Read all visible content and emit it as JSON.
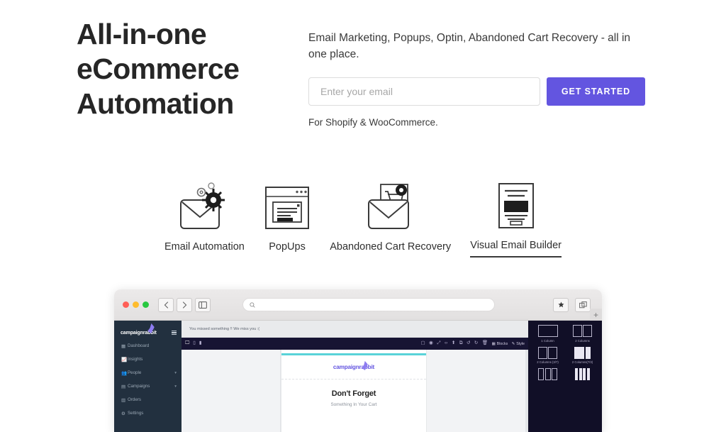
{
  "hero": {
    "headline": "All-in-one eCommerce Automation",
    "subhead": "Email Marketing, Popups, Optin, Abandoned Cart Recovery - all in one place.",
    "email_placeholder": "Enter your email",
    "email_value": "",
    "cta_label": "GET STARTED",
    "note": "For Shopify & WooCommerce.",
    "accent_color": "#6355e0"
  },
  "features": [
    {
      "label": "Email Automation",
      "icon": "email-gears-icon",
      "active": false
    },
    {
      "label": "PopUps",
      "icon": "popup-window-icon",
      "active": false
    },
    {
      "label": "Abandoned Cart Recovery",
      "icon": "cart-email-icon",
      "active": false
    },
    {
      "label": "Visual Email Builder",
      "icon": "email-template-icon",
      "active": true
    }
  ],
  "browser": {
    "traffic_lights": [
      "close-red",
      "minimize-yellow",
      "maximize-green"
    ],
    "back_icon": "chevron-left-icon",
    "forward_icon": "chevron-right-icon",
    "sidebar_icon": "sidebar-toggle-icon",
    "address_placeholder": "",
    "address_value": "",
    "search_icon": "search-icon",
    "bookmark_icon": "star-icon",
    "tabs_icon": "copy-tabs-icon",
    "new_tab_label": "+"
  },
  "app": {
    "sidebar": {
      "brand_first": "campaign",
      "brand_second": "rabbit",
      "menu_icon": "hamburger-icon",
      "items": [
        {
          "label": "Dashboard",
          "icon": "grid-icon",
          "expandable": false
        },
        {
          "label": "Insights",
          "icon": "chart-icon",
          "expandable": false
        },
        {
          "label": "People",
          "icon": "users-icon",
          "expandable": true
        },
        {
          "label": "Campaigns",
          "icon": "megaphone-icon",
          "expandable": true
        },
        {
          "label": "Orders",
          "icon": "trash-box-icon",
          "expandable": false
        },
        {
          "label": "Settings",
          "icon": "sliders-icon",
          "expandable": false
        }
      ],
      "chevron_icon": "chevron-down-icon",
      "bg_color": "#22303f"
    },
    "editor": {
      "subject": "You missed something !! We miss you :(",
      "toolbar_bg": "#171433",
      "device_icons": [
        "desktop-icon",
        "tablet-icon",
        "mobile-icon"
      ],
      "tool_icons": [
        "border-icon",
        "preview-eye-icon",
        "fullscreen-icon",
        "code-icon",
        "import-icon",
        "clone-icon",
        "undo-icon",
        "redo-icon",
        "delete-icon"
      ],
      "blocks_tab": "Blocks",
      "blocks_tab_icon": "blocks-icon",
      "style_tab": "Style",
      "style_tab_icon": "brush-icon"
    },
    "email": {
      "accent_bar_color": "#59d3d8",
      "logo_first": "campaign",
      "logo_second": "rabbit",
      "heading": "Don't Forget",
      "subtext": "Something In Your Cart"
    },
    "blocks_panel": {
      "bg_color": "#110f27",
      "items": [
        {
          "label": "1 Column",
          "cols": [
            1
          ]
        },
        {
          "label": "2 Columns",
          "cols": [
            1,
            1
          ]
        },
        {
          "label": "2 Columns (3/7)",
          "cols": [
            1,
            1
          ]
        },
        {
          "label": "2 Columns(7/3)",
          "cols": [
            1,
            1
          ]
        },
        {
          "label": "",
          "cols": [
            1,
            1,
            1
          ]
        },
        {
          "label": "",
          "cols": [
            1,
            1,
            1,
            1
          ]
        }
      ]
    }
  }
}
